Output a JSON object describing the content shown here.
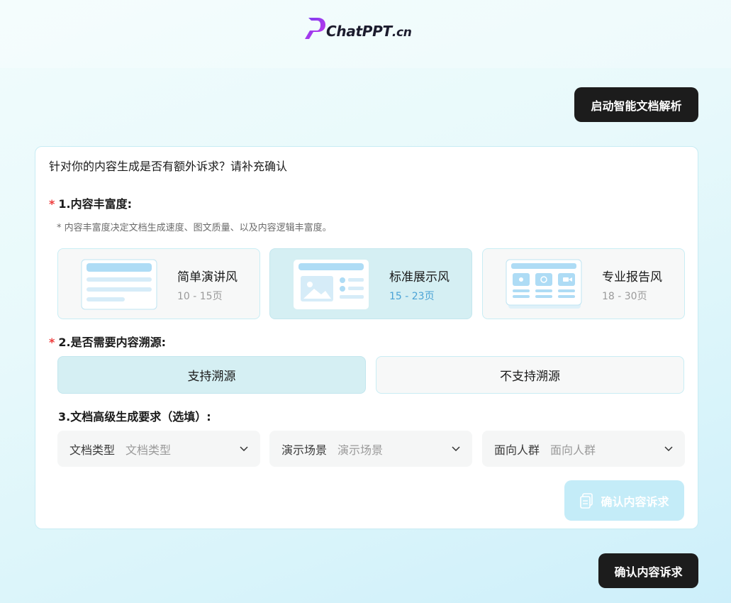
{
  "brand": {
    "logo_text": "ChatPPT",
    "logo_suffix": ".cn"
  },
  "header": {
    "parse_button": "启动智能文档解析"
  },
  "form": {
    "title": "针对你的内容生成是否有额外诉求？请补充确认",
    "richness": {
      "label": "1.内容丰富度:",
      "hint": "* 内容丰富度决定文档生成速度、图文质量、以及内容逻辑丰富度。",
      "options": [
        {
          "name": "简单演讲风",
          "range": "10 - 15页",
          "selected": false
        },
        {
          "name": "标准展示风",
          "range": "15 - 23页",
          "selected": true
        },
        {
          "name": "专业报告风",
          "range": "18 - 30页",
          "selected": false
        }
      ]
    },
    "source": {
      "label": "2.是否需要内容溯源:",
      "options": [
        {
          "label": "支持溯源",
          "selected": true
        },
        {
          "label": "不支持溯源",
          "selected": false
        }
      ]
    },
    "advanced": {
      "label": "3.文档高级生成要求（选填）:",
      "selects": [
        {
          "label": "文档类型",
          "placeholder": "文档类型"
        },
        {
          "label": "演示场景",
          "placeholder": "演示场景"
        },
        {
          "label": "面向人群",
          "placeholder": "面向人群"
        }
      ]
    },
    "confirm_request_button": "确认内容诉求"
  },
  "footer": {
    "confirm_button": "确认内容诉求"
  },
  "colors": {
    "accent": "#d5eff3",
    "dark": "#1c1c1c",
    "required": "#ee3b3b",
    "range_active": "#4aa3d6",
    "disabled": "#c4ecf8"
  }
}
